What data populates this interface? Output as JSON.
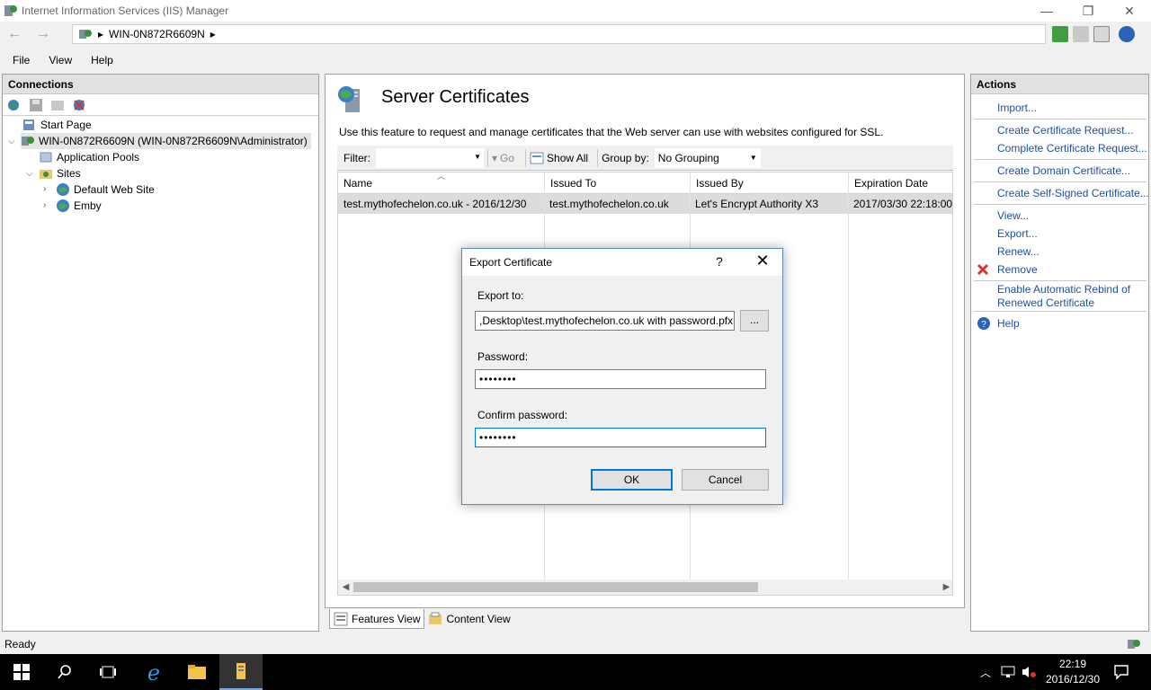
{
  "window": {
    "title": "Internet Information Services (IIS) Manager",
    "minimize": "—",
    "restore": "❐",
    "close": "✕"
  },
  "address": {
    "back": "←",
    "forward": "→",
    "server": "WIN-0N872R6609N",
    "sep": "▸"
  },
  "menu": [
    "File",
    "View",
    "Help"
  ],
  "connections": {
    "header": "Connections",
    "tree": {
      "start_page": "Start Page",
      "server": "WIN-0N872R6609N (WIN-0N872R6609N\\Administrator)",
      "app_pools": "Application Pools",
      "sites": "Sites",
      "default_site": "Default Web Site",
      "emby": "Emby"
    }
  },
  "center": {
    "title": "Server Certificates",
    "description": "Use this feature to request and manage certificates that the Web server can use with websites configured for SSL.",
    "filter_label": "Filter:",
    "filter_value": "",
    "go_label": "Go",
    "show_all_label": "Show All",
    "group_by_label": "Group by:",
    "group_by_value": "No Grouping",
    "columns": [
      "Name",
      "Issued To",
      "Issued By",
      "Expiration Date"
    ],
    "rows": [
      [
        "test.mythofechelon.co.uk - 2016/12/30",
        "test.mythofechelon.co.uk",
        "Let's Encrypt Authority X3",
        "2017/03/30 22:18:00"
      ]
    ],
    "features_view": "Features View",
    "content_view": "Content View"
  },
  "actions": {
    "header": "Actions",
    "items": {
      "import": "Import...",
      "create_request": "Create Certificate Request...",
      "complete_request": "Complete Certificate Request...",
      "create_domain": "Create Domain Certificate...",
      "create_self_signed": "Create Self-Signed Certificate...",
      "view": "View...",
      "export": "Export...",
      "renew": "Renew...",
      "remove": "Remove",
      "rebind_line1": "Enable Automatic Rebind of",
      "rebind_line2": "Renewed Certificate",
      "help": "Help"
    }
  },
  "status": "Ready",
  "dialog": {
    "title": "Export Certificate",
    "help": "?",
    "close": "✕",
    "export_to_label": "Export to:",
    "export_to_value": ",Desktop\\test.mythofechelon.co.uk with password.pfx",
    "browse": "...",
    "password_label": "Password:",
    "password_value": "••••••••",
    "confirm_label": "Confirm password:",
    "confirm_value": "••••••••",
    "ok": "OK",
    "cancel": "Cancel"
  },
  "taskbar": {
    "time": "22:19",
    "date": "2016/12/30"
  },
  "colors": {
    "link": "#1e4fa8",
    "accent": "#0078d7",
    "remove_icon": "#d9342b"
  }
}
